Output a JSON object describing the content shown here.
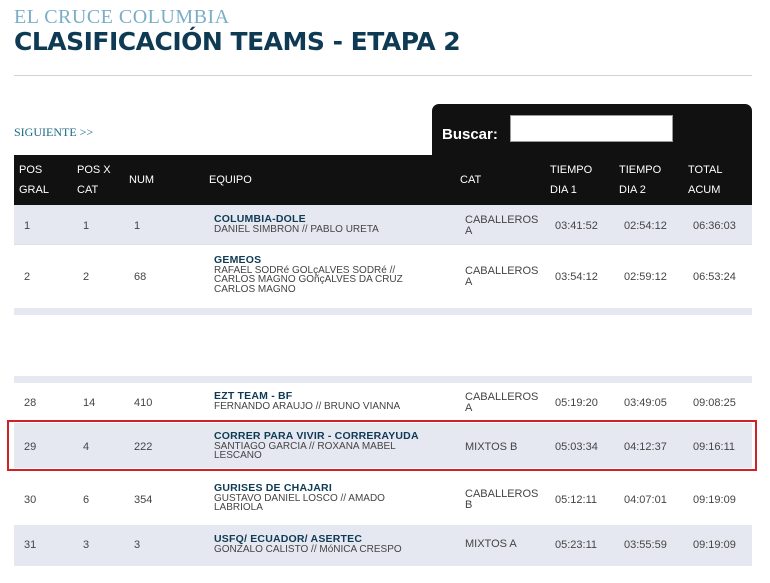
{
  "header": {
    "supertitle": "EL CRUCE COLUMBIA",
    "title": "CLASIFICACIÓN TEAMS - ETAPA 2"
  },
  "nav": {
    "next_label": "SIGUIENTE >>"
  },
  "search": {
    "label": "Buscar:",
    "value": "",
    "placeholder": ""
  },
  "table": {
    "headers": {
      "pos_gral": [
        "POS",
        "GRAL"
      ],
      "pos_cat": [
        "POS X",
        "CAT"
      ],
      "num": "NUM",
      "equipo": "EQUIPO",
      "cat": "CAT",
      "dia1": [
        "TIEMPO",
        "DIA 1"
      ],
      "dia2": [
        "TIEMPO",
        "DIA 2"
      ],
      "total": [
        "TOTAL",
        "ACUM"
      ]
    },
    "rows": [
      {
        "pos_gral": "1",
        "pos_cat": "1",
        "num": "1",
        "team": "COLUMBIA-DOLE",
        "members": [
          "DANIEL SIMBRON // PABLO URETA"
        ],
        "cat": "CABALLEROS A",
        "dia1": "03:41:52",
        "dia2": "02:54:12",
        "total": "06:36:03"
      },
      {
        "pos_gral": "2",
        "pos_cat": "2",
        "num": "68",
        "team": "GEMEOS",
        "members": [
          "RAFAEL SODRé GOLçALVES SODRé //",
          "CARLOS MAGNO GOñçALVES DA CRUZ",
          "CARLOS MAGNO"
        ],
        "cat": "CABALLEROS A",
        "dia1": "03:54:12",
        "dia2": "02:59:12",
        "total": "06:53:24"
      },
      {
        "pos_gral": "28",
        "pos_cat": "14",
        "num": "410",
        "team": "EZT TEAM - BF",
        "members": [
          "FERNANDO ARAUJO // BRUNO VIANNA"
        ],
        "cat": "CABALLEROS A",
        "dia1": "05:19:20",
        "dia2": "03:49:05",
        "total": "09:08:25"
      },
      {
        "pos_gral": "29",
        "pos_cat": "4",
        "num": "222",
        "team": "CORRER PARA VIVIR - CORRERAYUDA",
        "members": [
          "SANTIAGO GARCIA // ROXANA MABEL",
          "LESCANO"
        ],
        "cat": "MIXTOS B",
        "dia1": "05:03:34",
        "dia2": "04:12:37",
        "total": "09:16:11"
      },
      {
        "pos_gral": "30",
        "pos_cat": "6",
        "num": "354",
        "team": "GURISES DE CHAJARI",
        "members": [
          "GUSTAVO DANIEL LOSCO // AMADO",
          "LABRIOLA"
        ],
        "cat": "CABALLEROS B",
        "dia1": "05:12:11",
        "dia2": "04:07:01",
        "total": "09:19:09"
      },
      {
        "pos_gral": "31",
        "pos_cat": "3",
        "num": "3",
        "team": "USFQ/ ECUADOR/ ASERTEC",
        "members": [
          "GONZALO CALISTO // MóNICA CRESPO"
        ],
        "cat": "MIXTOS A",
        "dia1": "05:23:11",
        "dia2": "03:55:59",
        "total": "09:19:09"
      }
    ]
  },
  "colors": {
    "title": "#0e3a54",
    "supertitle": "#7aaec8",
    "header_bg": "#111111",
    "row_alt": "#e6e8f1",
    "highlight": "#d02127"
  }
}
